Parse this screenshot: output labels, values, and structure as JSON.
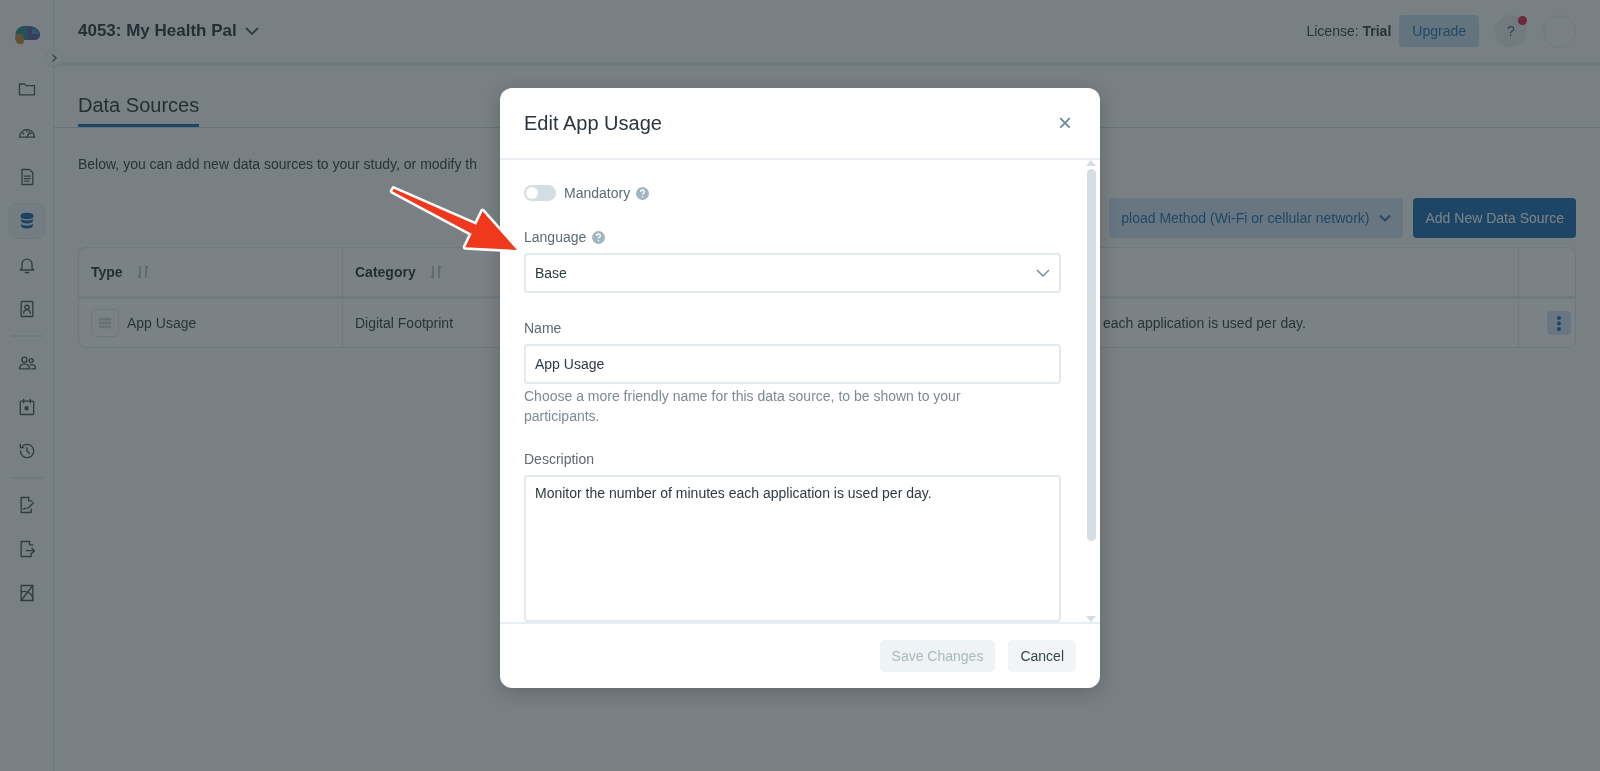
{
  "sidebar": {
    "sections": [
      {
        "items": [
          {
            "selected": false
          },
          {
            "selected": false
          },
          {
            "selected": false
          },
          {
            "selected": true
          },
          {
            "selected": false
          },
          {
            "selected": false
          }
        ]
      },
      {
        "items": [
          {
            "selected": false
          },
          {
            "selected": false
          },
          {
            "selected": false
          }
        ]
      },
      {
        "items": [
          {
            "selected": false
          },
          {
            "selected": false
          },
          {
            "selected": false
          }
        ]
      }
    ]
  },
  "header": {
    "project": "4053: My Health Pal",
    "license": "License: **Trial**",
    "upgrade_button": "Upgrade",
    "help_button": "?",
    "notification": true
  },
  "page": {
    "tabs": [
      {
        "label": "Data Sources",
        "selected": true
      }
    ],
    "intro": "Below, you can add new data sources to your study, or modify th",
    "upload_method_button": "pload Method (Wi-Fi or cellular network)",
    "add_button": "Add New Data Source"
  },
  "table": {
    "columns": [
      {
        "label": "Type",
        "sortable": true
      },
      {
        "label": "Category",
        "sortable": true
      }
    ],
    "rows": [
      {
        "type": "App Usage",
        "category": "Digital Footprint",
        "column_3": "each application is used per day."
      }
    ]
  },
  "modal": {
    "title": "Edit App Usage",
    "close_button": "×",
    "mandatory": {
      "label": "Mandatory",
      "on": false
    },
    "language": {
      "label": "Language",
      "value": "Base"
    },
    "name": {
      "label": "Name",
      "value": "App Usage",
      "hint": "Choose a more friendly name for this data source, to be shown to your participants."
    },
    "description": {
      "label": "Description",
      "value": "Monitor the number of minutes each application is used per day."
    },
    "buttons": [
      {
        "label": "Save Changes",
        "disabled": true
      },
      {
        "label": "Cancel",
        "disabled": false
      }
    ]
  }
}
